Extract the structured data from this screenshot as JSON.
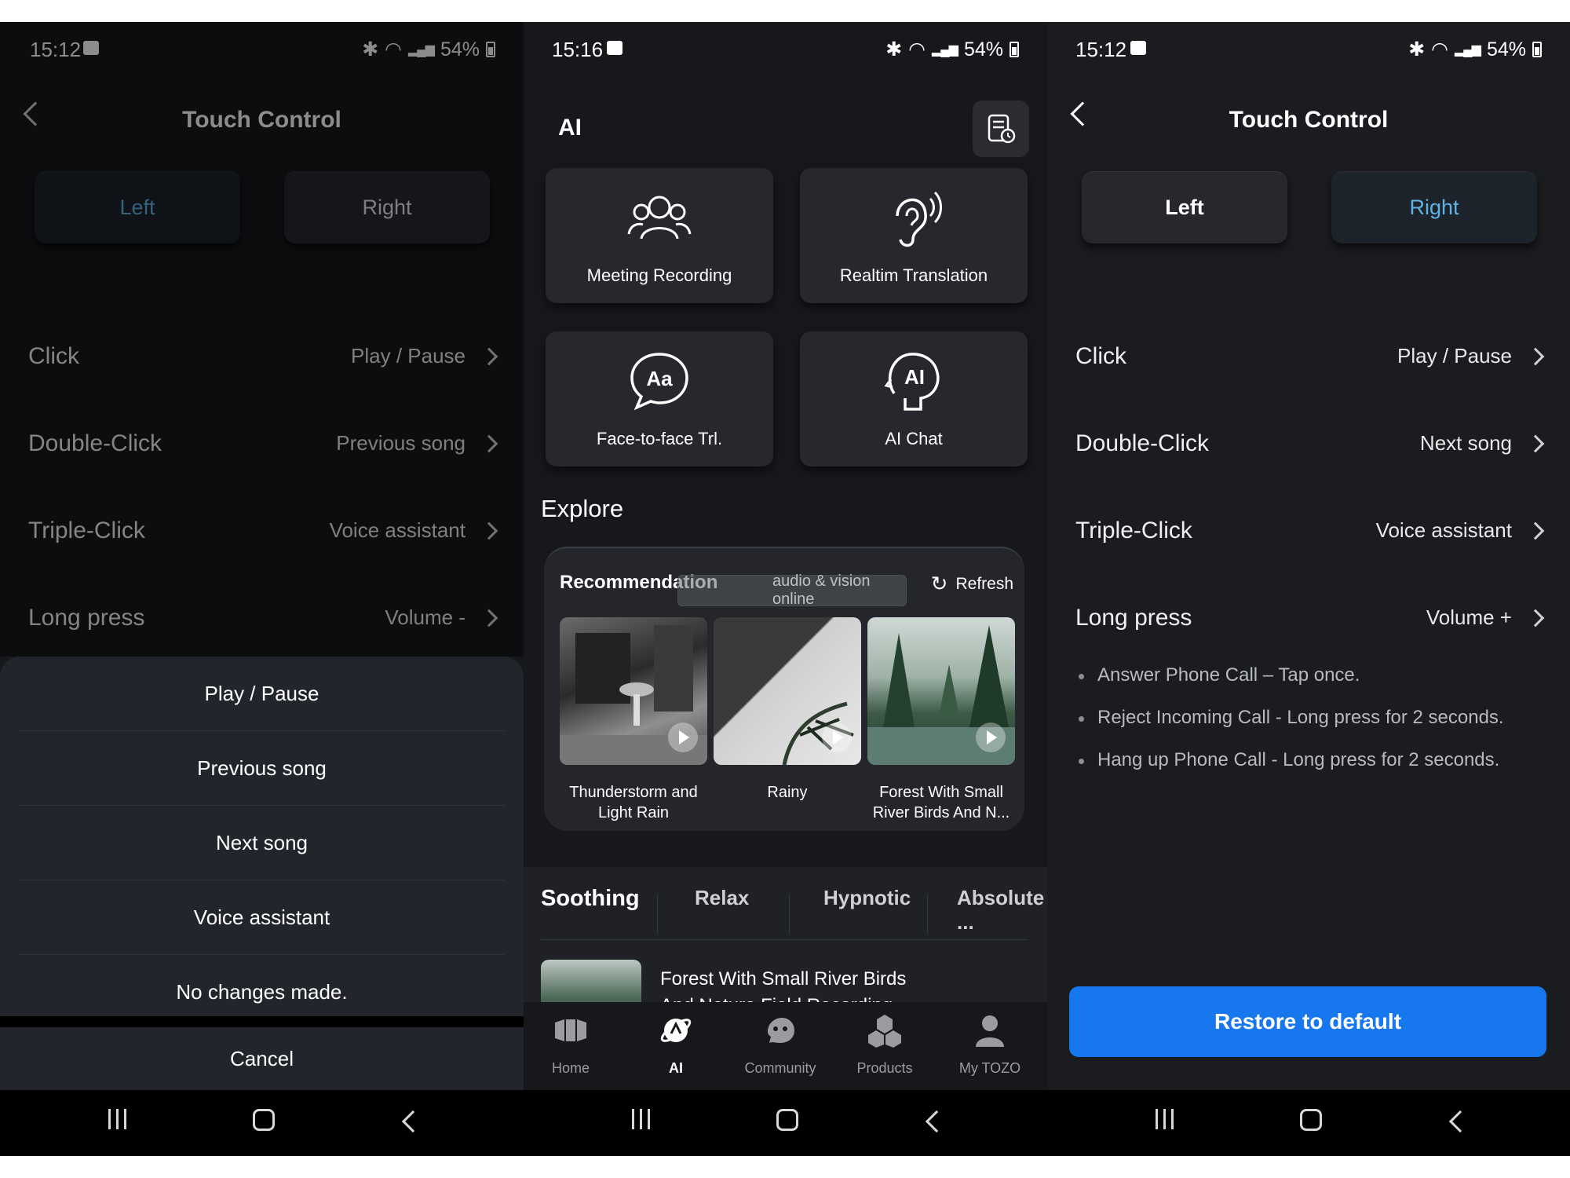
{
  "status_left": {
    "time": "15:12",
    "battery": "54%"
  },
  "status_mid": {
    "time": "15:16",
    "battery": "54%"
  },
  "status_right": {
    "time": "15:12",
    "battery": "54%"
  },
  "touch_left": {
    "title": "Touch Control",
    "tabs": {
      "left": "Left",
      "right": "Right",
      "active": "Left"
    },
    "rows": [
      {
        "label": "Click",
        "value": "Play / Pause"
      },
      {
        "label": "Double-Click",
        "value": "Previous song"
      },
      {
        "label": "Triple-Click",
        "value": "Voice assistant"
      },
      {
        "label": "Long press",
        "value": "Volume -"
      }
    ],
    "sheet": {
      "options": [
        "Play / Pause",
        "Previous song",
        "Next song",
        "Voice assistant",
        "No changes made."
      ],
      "cancel": "Cancel"
    }
  },
  "ai_screen": {
    "title": "AI",
    "cards": [
      {
        "label": "Meeting Recording",
        "icon": "people-icon"
      },
      {
        "label": "Realtim Translation",
        "icon": "ear-icon"
      },
      {
        "label": "Face-to-face Trl.",
        "icon": "aa-chat-icon"
      },
      {
        "label": "AI Chat",
        "icon": "ai-head-icon"
      }
    ],
    "explore": "Explore",
    "recommendation": {
      "title": "Recommendation",
      "refresh": "Refresh",
      "watermark": "audio & vision online",
      "items": [
        {
          "line1": "Thunderstorm and",
          "line2": "Light Rain"
        },
        {
          "line1": "Rainy",
          "line2": ""
        },
        {
          "line1": "Forest With Small",
          "line2": "River Birds And N..."
        }
      ]
    },
    "categories": [
      "Soothing",
      "Relax",
      "Hypnotic",
      "Absolute ..."
    ],
    "track": {
      "title": "Forest With Small River Birds",
      "subtitle": "And Nature Field Recording"
    },
    "tabbar": [
      {
        "label": "Home",
        "icon": "home-icon"
      },
      {
        "label": "AI",
        "icon": "ai-icon"
      },
      {
        "label": "Community",
        "icon": "community-icon"
      },
      {
        "label": "Products",
        "icon": "products-icon"
      },
      {
        "label": "My TOZO",
        "icon": "person-icon"
      }
    ],
    "active_tab": "AI"
  },
  "touch_right": {
    "title": "Touch Control",
    "tabs": {
      "left": "Left",
      "right": "Right",
      "active": "Right"
    },
    "rows": [
      {
        "label": "Click",
        "value": "Play / Pause"
      },
      {
        "label": "Double-Click",
        "value": "Next song"
      },
      {
        "label": "Triple-Click",
        "value": "Voice assistant"
      },
      {
        "label": "Long press",
        "value": "Volume +"
      }
    ],
    "tips": [
      "Answer Phone Call – Tap once.",
      "Reject Incoming Call - Long press for 2 seconds.",
      "Hang up Phone Call - Long press for 2 seconds."
    ],
    "restore": "Restore to default"
  },
  "colors": {
    "accent": "#5fb4e6",
    "button_blue": "#1677ef",
    "background": "#17181c"
  }
}
